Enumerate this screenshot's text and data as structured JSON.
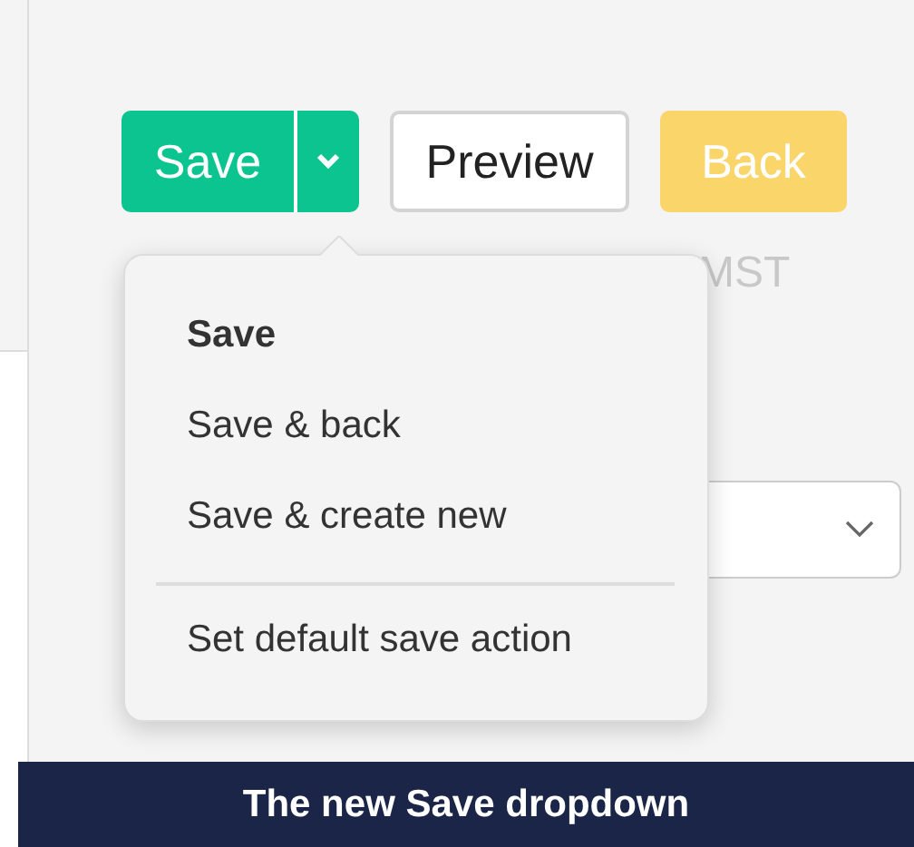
{
  "toolbar": {
    "save": {
      "label": "Save"
    },
    "preview": {
      "label": "Preview"
    },
    "back": {
      "label": "Back"
    }
  },
  "timezone_hint": "MST",
  "save_menu": {
    "items": [
      {
        "label": "Save",
        "selected": true
      },
      {
        "label": "Save & back",
        "selected": false
      },
      {
        "label": "Save & create new",
        "selected": false
      }
    ],
    "footer_item": {
      "label": "Set default save action"
    }
  },
  "caption": "The new Save dropdown"
}
